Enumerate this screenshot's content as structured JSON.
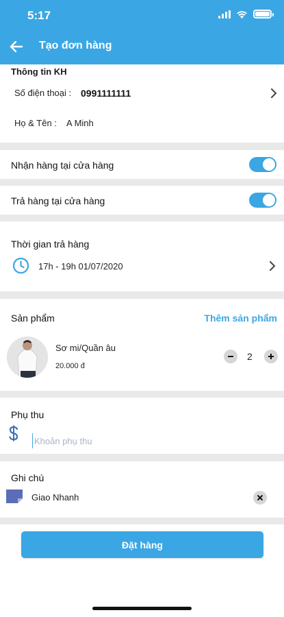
{
  "status_bar": {
    "time": "5:17"
  },
  "header": {
    "title": "Tạo đơn hàng"
  },
  "customer": {
    "section_title": "Thông tin KH",
    "phone_label": "Số điện thoại :",
    "phone_value": "0991111111",
    "name_label": "Họ & Tên :",
    "name_value": "A Minh"
  },
  "pickup_in_store": {
    "label": "Nhận hàng tại cửa hàng",
    "enabled": true
  },
  "return_in_store": {
    "label": "Trả hàng tại cửa hàng",
    "enabled": true
  },
  "delivery_time": {
    "section_title": "Thời gian trả hàng",
    "value": "17h - 19h 01/07/2020"
  },
  "products": {
    "section_title": "Sản phẩm",
    "add_label": "Thêm sản phẩm",
    "items": [
      {
        "name": "Sơ mi/Quần âu",
        "price": "20.000 đ",
        "quantity": "2"
      }
    ]
  },
  "surcharge": {
    "section_title": "Phụ thu",
    "placeholder": "Khoản phụ thu",
    "value": ""
  },
  "note": {
    "section_title": "Ghi chú",
    "value": "Giao Nhanh"
  },
  "order_button": {
    "label": "Đặt hàng"
  },
  "colors": {
    "primary": "#3ba6e4",
    "background": "#e9e9e9",
    "card": "#ffffff"
  }
}
